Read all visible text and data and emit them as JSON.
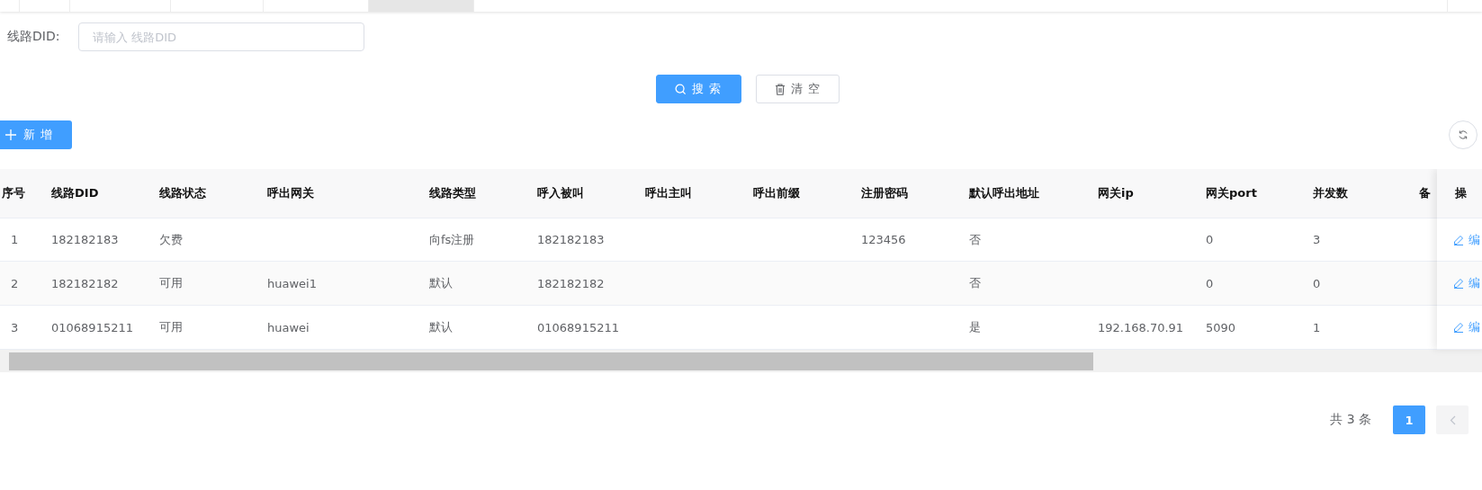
{
  "tab_bar": {
    "tabs": [
      {
        "selected": false
      },
      {
        "selected": false
      },
      {
        "selected": false
      },
      {
        "selected": false
      },
      {
        "selected": true
      }
    ]
  },
  "filter": {
    "label": "线路DID:",
    "placeholder": "请输入 线路DID"
  },
  "actions": [
    {
      "kind": "search",
      "label": "搜 索"
    },
    {
      "kind": "clear",
      "label": "清 空"
    }
  ],
  "toolbar": {
    "add_label": "新 增"
  },
  "table": {
    "columns": [
      "序号",
      "线路DID",
      "线路状态",
      "呼出网关",
      "线路类型",
      "呼入被叫",
      "呼出主叫",
      "呼出前缀",
      "注册密码",
      "默认呼出地址",
      "网关ip",
      "网关port",
      "并发数",
      "备"
    ],
    "action_column": "操",
    "rows": [
      {
        "cells": [
          "1",
          "182182183",
          "欠费",
          null,
          "向fs注册",
          "182182183",
          null,
          null,
          "123456",
          "否",
          null,
          "0",
          "3",
          null
        ],
        "action": "编"
      },
      {
        "cells": [
          "2",
          "182182182",
          "可用",
          "huawei1",
          "默认",
          "182182182",
          null,
          null,
          null,
          "否",
          null,
          "0",
          "0",
          null
        ],
        "action": "编"
      },
      {
        "cells": [
          "3",
          "01068915211",
          "可用",
          "huawei",
          "默认",
          "01068915211",
          null,
          null,
          null,
          "是",
          "192.168.70.91",
          "5090",
          "1",
          null
        ],
        "action": "编"
      }
    ]
  },
  "pagination": {
    "total": "共 3 条",
    "pages": [
      {
        "label": "1",
        "selected": true
      }
    ]
  }
}
